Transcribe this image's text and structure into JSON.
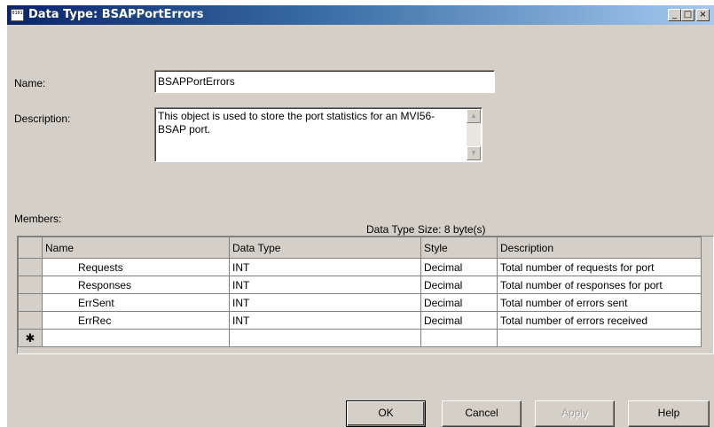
{
  "window": {
    "title": "Data Type: BSAPPortErrors",
    "icon_text": "0101",
    "controls": [
      "_",
      "□",
      "×"
    ]
  },
  "form": {
    "name_label": "Name:",
    "name_value": "BSAPPortErrors",
    "description_label": "Description:",
    "description_value": "This object is used to store the port statistics for an MVI56-BSAP port."
  },
  "members": {
    "label": "Members:",
    "size_text": "Data Type Size: 8 byte(s)",
    "columns": [
      "Name",
      "Data Type",
      "Style",
      "Description"
    ],
    "rows": [
      {
        "name": "Requests",
        "type": "INT",
        "style": "Decimal",
        "description": "Total number of requests for port"
      },
      {
        "name": "Responses",
        "type": "INT",
        "style": "Decimal",
        "description": "Total number of responses for port"
      },
      {
        "name": "ErrSent",
        "type": "INT",
        "style": "Decimal",
        "description": "Total number of errors sent"
      },
      {
        "name": "ErrRec",
        "type": "INT",
        "style": "Decimal",
        "description": "Total number of errors received"
      }
    ],
    "new_row_marker": "✱"
  },
  "buttons": {
    "ok": "OK",
    "cancel": "Cancel",
    "apply": "Apply",
    "help": "Help"
  }
}
